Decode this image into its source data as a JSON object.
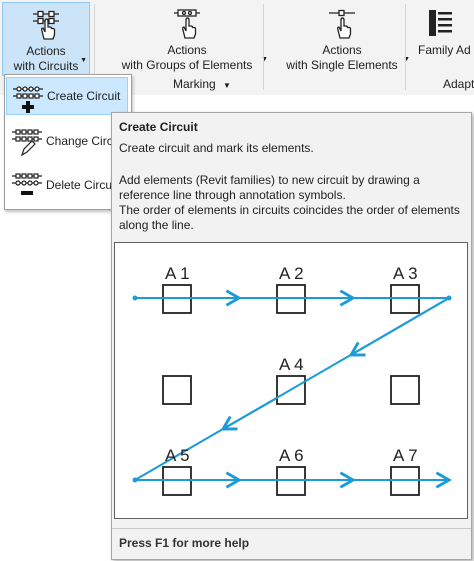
{
  "ribbon": {
    "btn_circuits": {
      "line1": "Actions",
      "line2": "with Circuits"
    },
    "btn_groups": {
      "line1": "Actions",
      "line2": "with Groups of Elements"
    },
    "btn_single": {
      "line1": "Actions",
      "line2": "with Single Elements"
    },
    "btn_family": {
      "line1": "Family Ad"
    },
    "group_marking": "Marking",
    "group_adapt": "Adapt"
  },
  "dropdown": {
    "items": [
      {
        "label": "Create Circuit"
      },
      {
        "label": "Change Circu"
      },
      {
        "label": "Delete Circuit"
      }
    ]
  },
  "tooltip": {
    "title": "Create Circuit",
    "desc": "Create circuit and mark its elements.",
    "para1_line1": "Add elements (Revit families) to new circuit by drawing a",
    "para1_line2": "reference line through annotation symbols.",
    "para2_line1": "The order of elements in circuits coincides the order of elements",
    "para2_line2": "along the line.",
    "help": "Press F1 for more help",
    "diagram_labels": [
      "A 1",
      "A 2",
      "A 3",
      "A 4",
      "A 5",
      "A 6",
      "A 7"
    ]
  },
  "colors": {
    "line": "#1b9bd7",
    "accent_bg": "#cce4f7"
  }
}
